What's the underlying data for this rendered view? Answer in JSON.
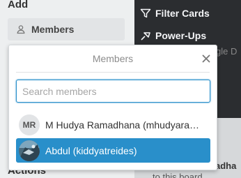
{
  "background": {
    "add_heading": "Add",
    "members_button_label": "Members",
    "actions_heading": "Actions",
    "sidebar_items": [
      {
        "label": "Filter Cards",
        "icon": "filter-icon"
      },
      {
        "label": "Power-Ups",
        "icon": "power-ups-icon"
      }
    ],
    "peek_text_google": "gle D",
    "peek_text_board_bold": "adha",
    "peek_text_board": "to this board"
  },
  "popover": {
    "title": "Members",
    "close_icon": "close-icon",
    "search_placeholder": "Search members",
    "search_value": "",
    "members": [
      {
        "initials": "MR",
        "name": "M Hudya Ramadhana (mhudyaram…",
        "selected": false
      },
      {
        "name": "Abdul (kiddyatreides)",
        "selected": true
      }
    ]
  },
  "colors": {
    "accent": "#298fca",
    "sidebar_dark": "#2b2d30",
    "panel_bg": "#edeff0"
  }
}
